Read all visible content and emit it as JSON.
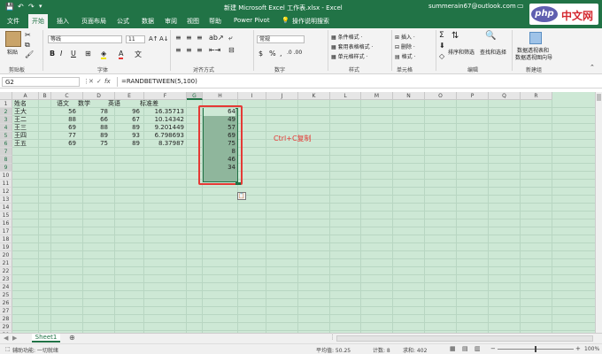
{
  "title": {
    "doc_title": "新建 Microsoft Excel 工作表.xlsx - Excel",
    "account": "summerain67@outlook.com"
  },
  "tabs": [
    "文件",
    "开始",
    "插入",
    "页面布局",
    "公式",
    "数据",
    "审阅",
    "视图",
    "帮助",
    "Power Pivot",
    "操作说明搜索"
  ],
  "ribbon": {
    "paste_label": "粘贴",
    "font_name": "等线",
    "font_size": "11",
    "number_format": "常规",
    "cond_format": "条件格式 ·",
    "table_format": "套用表格格式 ·",
    "cell_style": "单元格样式 ·",
    "insert": "插入 ·",
    "delete": "删除 ·",
    "format": "格式 ·",
    "sort_filter": "排序和筛选",
    "find_select": "查找和选择",
    "pivot": "数据透视表和",
    "pivot2": "数据透视图向导",
    "groups": [
      "剪贴板",
      "字体",
      "对齐方式",
      "数字",
      "样式",
      "单元格",
      "编辑",
      "新建组"
    ]
  },
  "formula_bar": {
    "name_box": "G2",
    "fx": "fx",
    "formula": "=RANDBETWEEN(5,100)"
  },
  "columns": [
    "A",
    "B",
    "C",
    "D",
    "E",
    "F",
    "G",
    "H",
    "I",
    "J",
    "K",
    "L",
    "M",
    "N",
    "O",
    "P",
    "Q",
    "R"
  ],
  "row_numbers": [
    "1",
    "2",
    "3",
    "4",
    "5",
    "6",
    "7",
    "8",
    "9",
    "10",
    "11",
    "12",
    "13",
    "14",
    "15",
    "16",
    "17",
    "18",
    "19",
    "20",
    "21",
    "22",
    "23",
    "24",
    "25",
    "26",
    "27",
    "28",
    "29",
    "30"
  ],
  "table": {
    "headers": [
      "姓名",
      "语文",
      "数学",
      "英语",
      "标准差"
    ],
    "rows": [
      [
        "王大",
        "56",
        "78",
        "96",
        "16.35713"
      ],
      [
        "王二",
        "88",
        "66",
        "67",
        "10.14342"
      ],
      [
        "王三",
        "69",
        "88",
        "89",
        "9.201449"
      ],
      [
        "王四",
        "77",
        "89",
        "93",
        "6.798693"
      ],
      [
        "王五",
        "69",
        "75",
        "89",
        "8.37987"
      ]
    ]
  },
  "column_g": [
    "64",
    "49",
    "57",
    "69",
    "75",
    "8",
    "46",
    "34"
  ],
  "annotation": "Ctrl+C复制",
  "sheet_tab": "Sheet1",
  "status": {
    "left": "辅助功能: 一切就绪",
    "average": "平均值: 50.25",
    "count": "计数: 8",
    "sum": "求和: 402",
    "zoom": "100%"
  },
  "watermark": "php 中文网",
  "colors": {
    "excel_green": "#217346",
    "grid_green": "#cde8d5",
    "annotation_red": "#e53935"
  }
}
